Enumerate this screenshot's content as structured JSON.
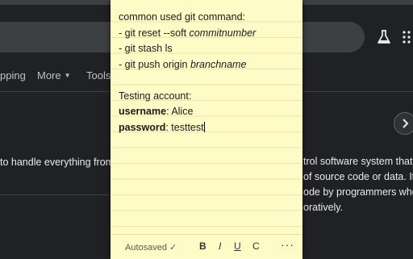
{
  "browser": {
    "tabs": [
      "pping",
      "More",
      "Tools"
    ]
  },
  "results": {
    "left_snippet": "to handle everything from s",
    "right_snippet_lines": [
      "trol software system that is",
      "of source code or data. It is",
      "ode by programmers who",
      "oratively."
    ]
  },
  "note": {
    "line1": "common used git command:",
    "line2_prefix": "- git reset --soft ",
    "line2_italic": "commitnumber",
    "line3": "- git stash ls",
    "line4_prefix": "- git push origin ",
    "line4_italic": "branchname",
    "line6": "Testing account:",
    "username_label": "username",
    "username_value": ": Alice",
    "password_label": "password",
    "password_value": ": testtest",
    "autosaved": "Autosaved ✓",
    "bold_btn": "B",
    "italic_btn": "I",
    "underline_btn": "U",
    "strike_btn": "C",
    "more_btn": "···"
  },
  "icons": {
    "flask": "flask-icon",
    "apps": "apps-grid-icon",
    "chevron": "chevron-right-icon"
  }
}
